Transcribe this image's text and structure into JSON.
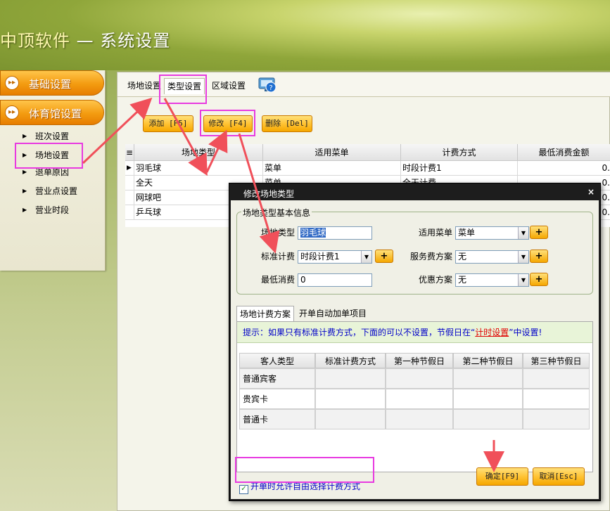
{
  "app": {
    "brand": "中顶软件",
    "title_rest": " — 系统设置"
  },
  "leftnav": {
    "sections": [
      {
        "label": "基础设置"
      },
      {
        "label": "体育馆设置"
      }
    ],
    "items": [
      {
        "label": "班次设置"
      },
      {
        "label": "场地设置"
      },
      {
        "label": "退单原因"
      },
      {
        "label": "营业点设置"
      },
      {
        "label": "营业时段"
      }
    ]
  },
  "tabs": [
    {
      "label": "场地设置"
    },
    {
      "label": "类型设置"
    },
    {
      "label": "区域设置"
    }
  ],
  "toolbar": {
    "add": "添加 [F5]",
    "edit": "修改 [F4]",
    "delete": "删除 [Del]"
  },
  "grid": {
    "columns": [
      "场地类型",
      "适用菜单",
      "计费方式",
      "最低消费金额"
    ],
    "rows": [
      {
        "type": "羽毛球",
        "menu": "菜单",
        "billing": "时段计费1",
        "min": "0."
      },
      {
        "type": "全天",
        "menu": "菜单",
        "billing": "全天计费",
        "min": "0."
      },
      {
        "type": "网球吧",
        "menu": "",
        "billing": "",
        "min": "0."
      },
      {
        "type": "乒乓球",
        "menu": "",
        "billing": "",
        "min": "0."
      }
    ]
  },
  "dialog": {
    "title": "修改场地类型",
    "close": "×",
    "legend": "场地类型基本信息",
    "fields": {
      "venue_type_label": "场地类型",
      "venue_type_value": "羽毛球",
      "menu_label": "适用菜单",
      "menu_value": "菜单",
      "std_billing_label": "标准计费",
      "std_billing_value": "时段计费1",
      "service_label": "服务费方案",
      "service_value": "无",
      "min_label": "最低消费",
      "min_value": "0",
      "discount_label": "优惠方案",
      "discount_value": "无"
    },
    "subtabs": [
      {
        "label": "场地计费方案"
      },
      {
        "label": "开单自动加单项目"
      }
    ],
    "hint_prefix": "提示：如果只有标准计费方式，下面的可以不设置，节假日在“",
    "hint_link": "计时设置",
    "hint_suffix": "”中设置!",
    "rate_table": {
      "columns": [
        "客人类型",
        "标准计费方式",
        "第一种节假日",
        "第二种节假日",
        "第三种节假日"
      ],
      "rows": [
        "普通宾客",
        "贵宾卡",
        "普通卡"
      ]
    },
    "checkbox_label": "开单时允许自由选择计费方式",
    "checkbox_checked": true,
    "ok": "确定[F9]",
    "cancel": "取消[Esc]"
  },
  "colors": {
    "accent_orange": "#f39b10",
    "highlight": "#e83ae0",
    "arrow": "#f0505a"
  }
}
